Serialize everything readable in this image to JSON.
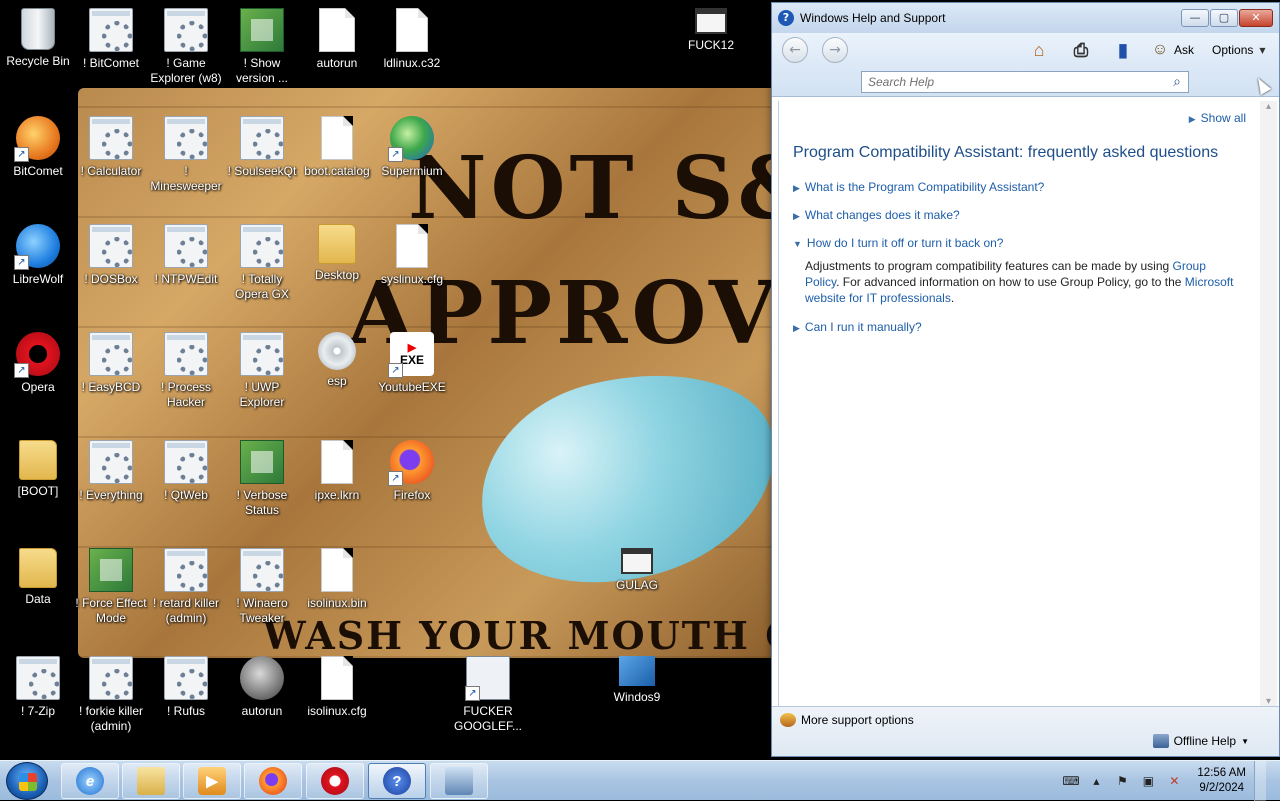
{
  "wallpaper": {
    "line1": "NOT S&",
    "line2": "APPROV",
    "line3": "WASH YOUR MOUTH OUT"
  },
  "desktop_icons": [
    {
      "label": "Recycle Bin",
      "icon": "recycle-bin-icon"
    },
    {
      "label": "! BitComet",
      "icon": "setup-icon"
    },
    {
      "label": "! Game Explorer (w8)",
      "icon": "setup-icon"
    },
    {
      "label": "! Show version ...",
      "icon": "registry-icon"
    },
    {
      "label": "autorun",
      "icon": "settings-file-icon"
    },
    {
      "label": "ldlinux.c32",
      "icon": "file-icon"
    },
    {
      "label": "FUCK12",
      "icon": "window-icon"
    },
    {
      "label": "BitComet",
      "icon": "bitcomet-icon"
    },
    {
      "label": "! Calculator",
      "icon": "setup-icon"
    },
    {
      "label": "! Minesweeper",
      "icon": "setup-icon"
    },
    {
      "label": "! SoulseekQt",
      "icon": "setup-icon"
    },
    {
      "label": "boot.catalog",
      "icon": "file-icon"
    },
    {
      "label": "Supermium",
      "icon": "supermium-icon"
    },
    {
      "label": "LibreWolf",
      "icon": "librewolf-icon"
    },
    {
      "label": "! DOSBox",
      "icon": "setup-icon"
    },
    {
      "label": "! NTPWEdit",
      "icon": "setup-icon"
    },
    {
      "label": "! Totally Opera GX",
      "icon": "setup-icon"
    },
    {
      "label": "Desktop",
      "icon": "folder-icon"
    },
    {
      "label": "syslinux.cfg",
      "icon": "file-icon"
    },
    {
      "label": "Opera",
      "icon": "opera-icon"
    },
    {
      "label": "! EasyBCD",
      "icon": "setup-icon"
    },
    {
      "label": "! Process Hacker",
      "icon": "setup-icon"
    },
    {
      "label": "! UWP Explorer",
      "icon": "setup-icon"
    },
    {
      "label": "esp",
      "icon": "disc-icon"
    },
    {
      "label": "YoutubeEXE",
      "icon": "youtube-icon"
    },
    {
      "label": "[BOOT]",
      "icon": "folder-icon"
    },
    {
      "label": "! Everything",
      "icon": "setup-icon"
    },
    {
      "label": "! QtWeb",
      "icon": "setup-icon"
    },
    {
      "label": "! Verbose Status",
      "icon": "registry-icon"
    },
    {
      "label": "ipxe.lkrn",
      "icon": "file-icon"
    },
    {
      "label": "Firefox",
      "icon": "firefox-icon"
    },
    {
      "label": "Data",
      "icon": "folder-icon"
    },
    {
      "label": "! Force Effect Mode",
      "icon": "registry-icon"
    },
    {
      "label": "! retard killer (admin)",
      "icon": "setup-icon"
    },
    {
      "label": "! Winaero Tweaker",
      "icon": "setup-icon"
    },
    {
      "label": "isolinux.bin",
      "icon": "file-icon"
    },
    {
      "label": "GULAG",
      "icon": "window-icon"
    },
    {
      "label": "! 7-Zip",
      "icon": "setup-icon"
    },
    {
      "label": "! forkie killer (admin)",
      "icon": "setup-icon"
    },
    {
      "label": "! Rufus",
      "icon": "setup-icon"
    },
    {
      "label": "autorun",
      "icon": "wolf-icon"
    },
    {
      "label": "isolinux.cfg",
      "icon": "file-icon"
    },
    {
      "label": "FUCKER GOOGLEF...",
      "icon": "app-window-icon"
    },
    {
      "label": "Windos9",
      "icon": "windos-icon"
    }
  ],
  "help_window": {
    "title": "Windows Help and Support",
    "controls": {
      "minimize": "—",
      "maximize": "▢",
      "close": "✕"
    },
    "toolbar": {
      "ask_label": "Ask",
      "options_label": "Options"
    },
    "search": {
      "placeholder": "Search Help",
      "value": ""
    },
    "show_all": "Show all",
    "heading": "Program Compatibility Assistant: frequently asked questions",
    "faq": [
      {
        "question": "What is the Program Compatibility Assistant?",
        "expanded": false
      },
      {
        "question": "What changes does it make?",
        "expanded": false
      },
      {
        "question": "How do I turn it off or turn it back on?",
        "expanded": true
      },
      {
        "question": "Can I run it manually?",
        "expanded": false
      }
    ],
    "answer": {
      "part1": "Adjustments to program compatibility features can be made by using",
      "link1": "Group Policy",
      "part2": ". For advanced information on how to use Group Policy, go to the",
      "link2": "Microsoft website for IT professionals",
      "part3": "."
    },
    "footer": {
      "more_support": "More support options",
      "offline_help": "Offline Help"
    }
  },
  "taskbar": {
    "clock_time": "12:56 AM",
    "clock_date": "9/2/2024"
  },
  "colors": {
    "link": "#1e5ea8",
    "heading": "#1e4e8a",
    "taskbar": "#a9c4e2"
  }
}
